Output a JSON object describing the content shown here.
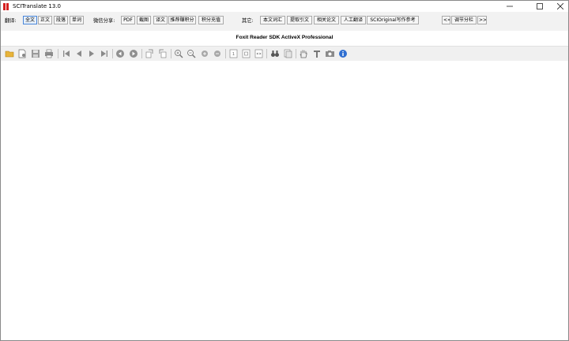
{
  "window": {
    "title": "SCITranslate 13.0"
  },
  "translate": {
    "label": "翻译:",
    "modes": [
      "全文",
      "正文",
      "段落",
      "单词"
    ]
  },
  "wechat": {
    "label": "微信分享:",
    "buttons": [
      "PDF",
      "截图",
      "译文",
      "推荐赚积分",
      "积分充值"
    ]
  },
  "other": {
    "label": "其它:",
    "buttons": [
      "本文词汇",
      "提取引文",
      "相关论文",
      "人工翻译",
      "SCIOriginal写作参考"
    ]
  },
  "panel": {
    "prev": "<<",
    "adjust": "调节分栏",
    "next": ">>"
  },
  "viewer": {
    "title": "Foxit Reader SDK ActiveX Professional"
  },
  "colors": {
    "accent": "#4a86d8",
    "brand": "#d42020",
    "folder": "#e8b43a"
  }
}
